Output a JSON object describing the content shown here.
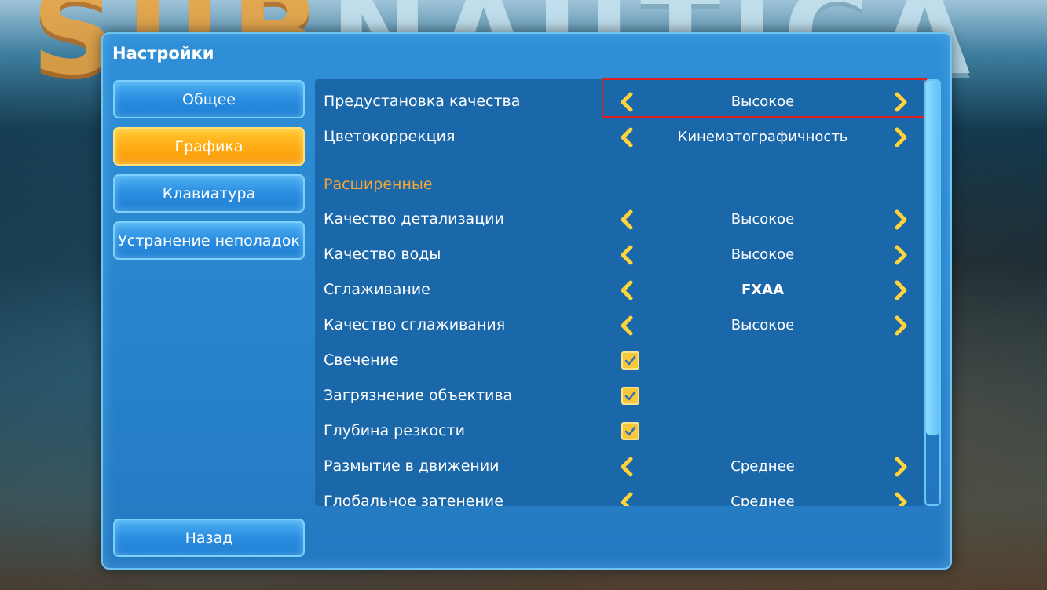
{
  "background": {
    "title_left": "SUB",
    "title_right": "NAUTICA"
  },
  "panel": {
    "title": "Настройки"
  },
  "nav": {
    "items": [
      {
        "label": "Общее",
        "active": false
      },
      {
        "label": "Графика",
        "active": true
      },
      {
        "label": "Клавиатура",
        "active": false
      },
      {
        "label": "Устранение неполадок",
        "active": false
      }
    ],
    "back_label": "Назад"
  },
  "settings": {
    "rows": [
      {
        "label": "Предустановка качества",
        "value": "Высокое"
      },
      {
        "label": "Цветокоррекция",
        "value": "Кинематографичность"
      }
    ],
    "advanced_title": "Расширенные",
    "advanced": [
      {
        "label": "Качество детализации",
        "value": "Высокое"
      },
      {
        "label": "Качество воды",
        "value": "Высокое"
      },
      {
        "label": "Сглаживание",
        "value": "FXAA"
      },
      {
        "label": "Качество сглаживания",
        "value": "Высокое"
      },
      {
        "label": "Свечение",
        "checked": true
      },
      {
        "label": "Загрязнение объектива",
        "checked": true
      },
      {
        "label": "Глубина резкости",
        "checked": true
      },
      {
        "label": "Размытие в движении",
        "value": "Среднее"
      },
      {
        "label": "Глобальное затенение",
        "value": "Среднее"
      }
    ]
  },
  "colors": {
    "panel": "#2783cc",
    "list_bg": "#1a67aa",
    "active_tab": "#ffab14",
    "section_title": "#f5a53a",
    "arrow": "#ffd43a",
    "highlight": "#e0201e"
  },
  "icons": {
    "arrow_left": "chevron-left-icon",
    "arrow_right": "chevron-right-icon",
    "checkbox": "checkmark-icon"
  }
}
